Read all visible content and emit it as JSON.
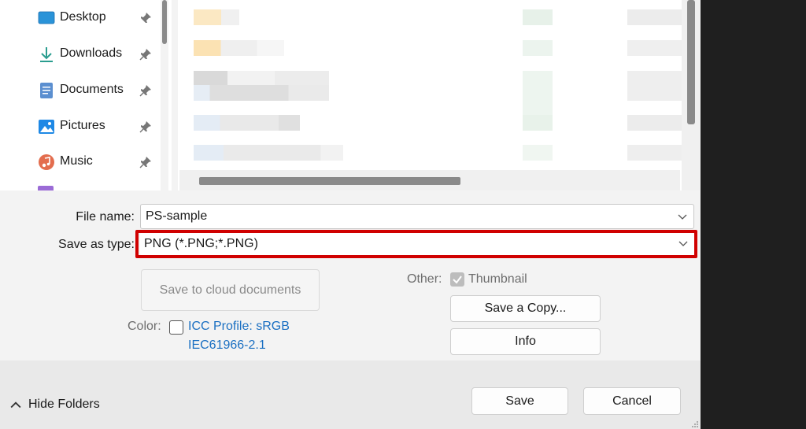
{
  "sidebar": {
    "items": [
      {
        "label": "Desktop",
        "icon": "desktop-icon"
      },
      {
        "label": "Downloads",
        "icon": "download-arrow-icon"
      },
      {
        "label": "Documents",
        "icon": "document-icon"
      },
      {
        "label": "Pictures",
        "icon": "picture-icon"
      },
      {
        "label": "Music",
        "icon": "music-icon"
      }
    ]
  },
  "form": {
    "file_name_label": "File name:",
    "file_name_value": "PS-sample",
    "save_type_label": "Save as type:",
    "save_type_value": "PNG (*.PNG;*.PNG)",
    "save_cloud_label": "Save to cloud documents",
    "other_label": "Other:",
    "thumbnail_label": "Thumbnail",
    "thumbnail_checked": true,
    "color_label": "Color:",
    "icc_line1": "ICC Profile:  sRGB",
    "icc_line2": "IEC61966-2.1",
    "icc_checked": false,
    "save_copy_label": "Save a Copy...",
    "info_label": "Info"
  },
  "footer": {
    "hide_folders_label": "Hide Folders",
    "save_label": "Save",
    "cancel_label": "Cancel"
  },
  "colors": {
    "highlight": "#d00000",
    "link": "#1a6fc2"
  }
}
